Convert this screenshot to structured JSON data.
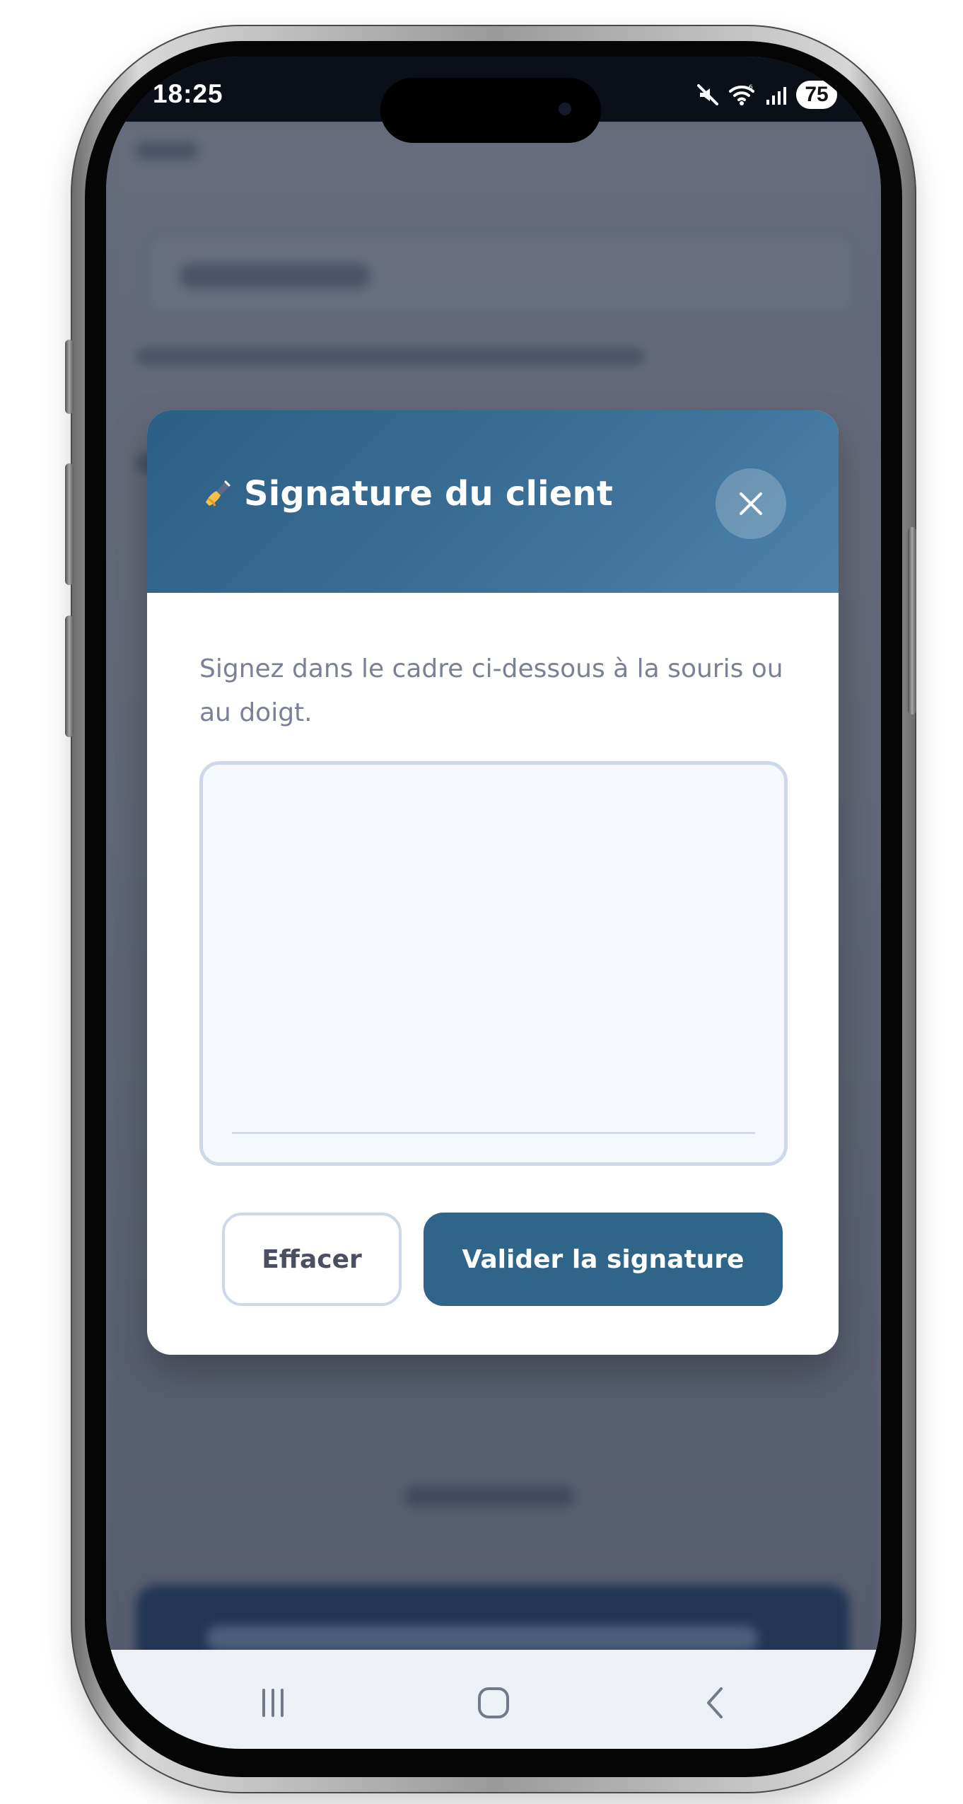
{
  "status_bar": {
    "time": "18:25",
    "battery": "75",
    "icons": [
      "mute-icon",
      "wifi-icon",
      "signal-icon"
    ]
  },
  "modal": {
    "title": "Signature du client",
    "instruction": "Signez dans le cadre ci-dessous à la souris ou au doigt.",
    "clear_label": "Effacer",
    "validate_label": "Valider la signature",
    "icons": [
      "pen-icon",
      "close-icon"
    ]
  },
  "navigation": {
    "icons": [
      "recent-apps-icon",
      "home-icon",
      "back-icon"
    ]
  },
  "colors": {
    "header": "#3b6f96",
    "primary": "#2f6589",
    "text_muted": "#7a8196",
    "border": "#cfd8e8"
  }
}
